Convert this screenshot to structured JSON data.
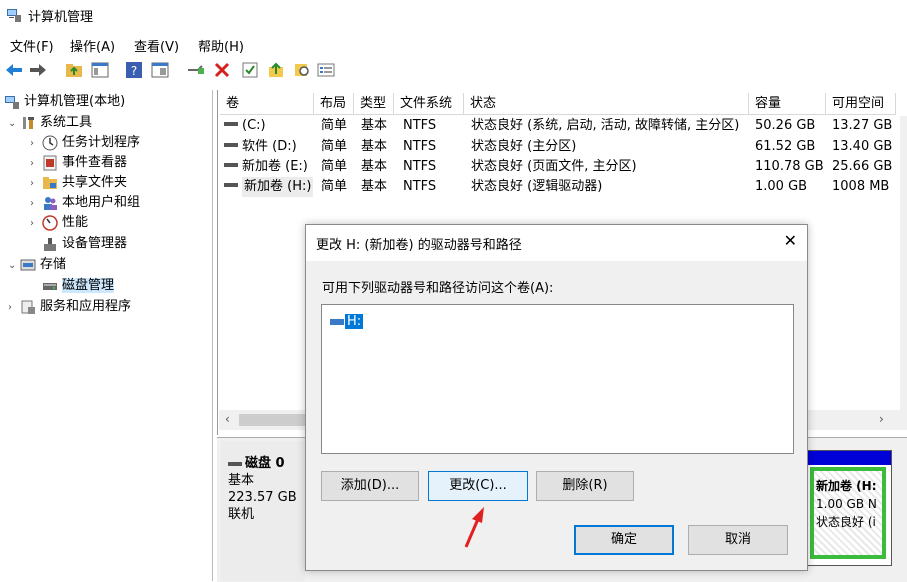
{
  "window": {
    "title": "计算机管理"
  },
  "menu": [
    "文件(F)",
    "操作(A)",
    "查看(V)",
    "帮助(H)"
  ],
  "tree": {
    "root": "计算机管理(本地)",
    "system_tools": "系统工具",
    "task_scheduler": "任务计划程序",
    "event_viewer": "事件查看器",
    "shared_folders": "共享文件夹",
    "local_users": "本地用户和组",
    "performance": "性能",
    "device_manager": "设备管理器",
    "storage": "存储",
    "disk_management": "磁盘管理",
    "services_apps": "服务和应用程序"
  },
  "volumes": {
    "headers": [
      "卷",
      "布局",
      "类型",
      "文件系统",
      "状态",
      "容量",
      "可用空间"
    ],
    "rows": [
      [
        "(C:)",
        "简单",
        "基本",
        "NTFS",
        "状态良好 (系统, 启动, 活动, 故障转储, 主分区)",
        "50.26 GB",
        "13.27 GB"
      ],
      [
        "软件 (D:)",
        "简单",
        "基本",
        "NTFS",
        "状态良好 (主分区)",
        "61.52 GB",
        "13.40 GB"
      ],
      [
        "新加卷 (E:)",
        "简单",
        "基本",
        "NTFS",
        "状态良好 (页面文件, 主分区)",
        "110.78 GB",
        "25.66 GB"
      ],
      [
        "新加卷 (H:)",
        "简单",
        "基本",
        "NTFS",
        "状态良好 (逻辑驱动器)",
        "1.00 GB",
        "1008 MB"
      ]
    ]
  },
  "disk": {
    "name": "磁盘 0",
    "type": "基本",
    "size": "223.57 GB",
    "state": "联机",
    "partition_name": "新加卷 (H:",
    "partition_size": "1.00 GB N",
    "partition_status": "状态良好 (i"
  },
  "dialog": {
    "title": "更改 H: (新加卷) 的驱动器号和路径",
    "close": "✕",
    "prompt": "可用下列驱动器号和路径访问这个卷(A):",
    "path_item": "H:",
    "add_label": "添加(D)...",
    "change_label": "更改(C)...",
    "remove_label": "删除(R)",
    "ok_label": "确定",
    "cancel_label": "取消"
  },
  "colors": {
    "accent": "#0078d7",
    "selection": "#cce8ff",
    "arrow": "#e02020"
  }
}
